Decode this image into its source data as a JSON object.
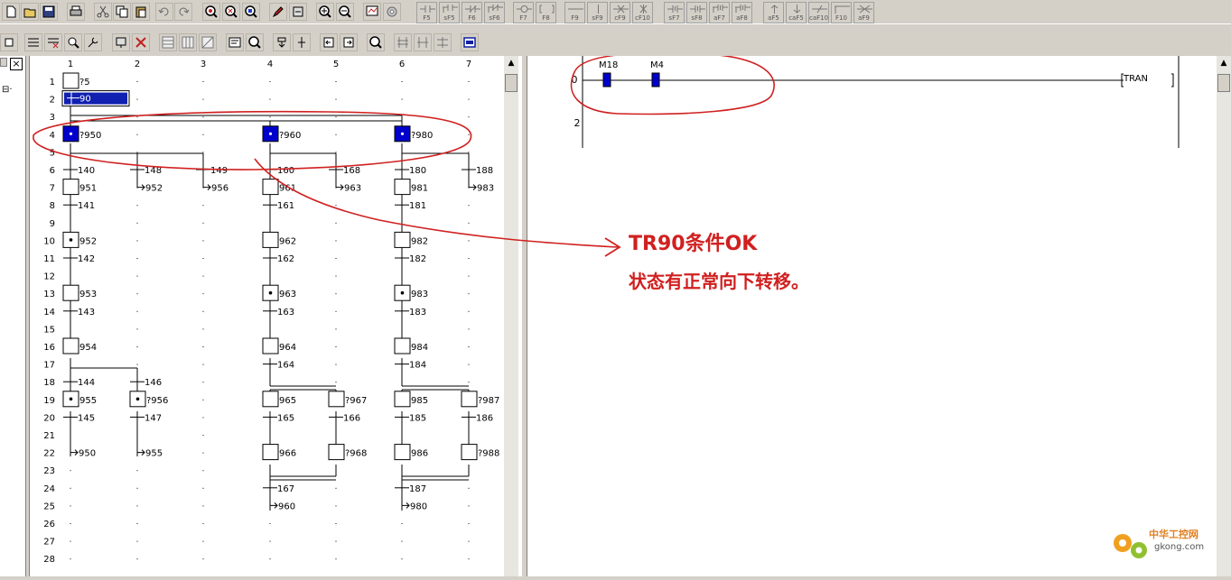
{
  "fkeys_row1": [
    "F5",
    "sF5",
    "F6",
    "sF6",
    "F7",
    "F8",
    "F9",
    "sF9",
    "cF9",
    "cF10",
    "sF7",
    "sF8",
    "aF7",
    "aF8",
    "aF5",
    "caF5",
    "caF10",
    "F10",
    "aF9"
  ],
  "left_strip": {
    "close_label": "×",
    "tree_label": "⊟·"
  },
  "sfc": {
    "columns": [
      "1",
      "2",
      "3",
      "4",
      "5",
      "6",
      "7"
    ],
    "rows": [
      "1",
      "2",
      "3",
      "4",
      "5",
      "6",
      "7",
      "8",
      "9",
      "10",
      "11",
      "12",
      "13",
      "14",
      "15",
      "16",
      "17",
      "18",
      "19",
      "20",
      "21",
      "22",
      "23",
      "24",
      "25",
      "26",
      "27",
      "28"
    ],
    "step_labels": {
      "s5": "?5",
      "s90": "90",
      "s950": "?950",
      "s960": "?960",
      "s980": "?980",
      "s951": "951",
      "s961": "961",
      "s981": "981",
      "s952": "952",
      "s962": "962",
      "s982": "982",
      "s953": "953",
      "s963": "963",
      "s983": "983",
      "s954": "954",
      "s964": "964",
      "s984": "984",
      "s955": "955",
      "s956": "?956",
      "s965": "965",
      "s967": "?967",
      "s985": "985",
      "s987": "?987",
      "s966": "966",
      "s968": "?968",
      "s986": "986",
      "s988": "?988"
    },
    "transition_labels": {
      "t140": "140",
      "t148": "148",
      "t149": "149",
      "t160": "160",
      "t168": "168",
      "t180": "180",
      "t188": "188",
      "t141": "141",
      "t161": "161",
      "t181": "181",
      "t142": "142",
      "t162": "162",
      "t182": "182",
      "t143": "143",
      "t163": "163",
      "t183": "183",
      "t164": "164",
      "t184": "184",
      "t144": "144",
      "t146": "146",
      "t145": "145",
      "t147": "147",
      "t165": "165",
      "t166": "166",
      "t185": "185",
      "t186": "186",
      "t167": "167",
      "t187": "187"
    },
    "jump_labels": {
      "j952": "952",
      "j956": "956",
      "j963": "963",
      "j983": "983",
      "j950": "950",
      "j955": "955",
      "j960": "960",
      "j980": "980"
    }
  },
  "ladder": {
    "rung_numbers": [
      "0",
      "2"
    ],
    "contact1": "M18",
    "contact2": "M4",
    "coil": "TRAN"
  },
  "annotation": {
    "line1": "TR90条件OK",
    "line2": "状态有正常向下转移。"
  },
  "watermark": {
    "text1": "中华工控网",
    "text2": "gkong.com"
  },
  "colors": {
    "active": "#0000cc",
    "annotation": "#d02020"
  }
}
